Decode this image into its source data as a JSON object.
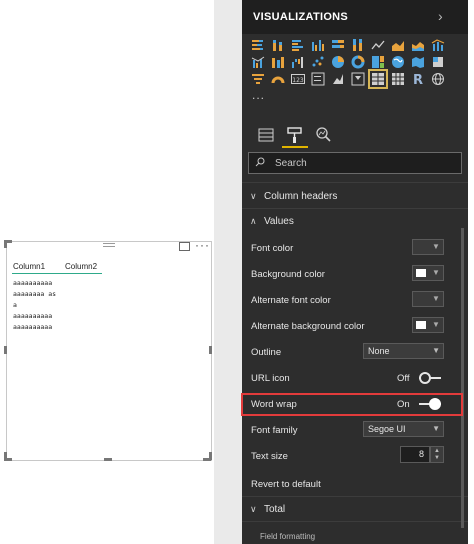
{
  "pane": {
    "title": "VISUALIZATIONS",
    "gallery_more": "...",
    "search_placeholder": "Search"
  },
  "visual": {
    "columns": [
      "Column1",
      "Column2"
    ],
    "rows": [
      "aaaaaaaaaa",
      "aaaaaaaa as",
      "a",
      "aaaaaaaaaa",
      "aaaaaaaaaa"
    ]
  },
  "format": {
    "sections": {
      "column_headers": "Column headers",
      "values": "Values",
      "total": "Total",
      "field_formatting_partial": "Field formatting"
    },
    "rows": {
      "font_color": "Font color",
      "background_color": "Background color",
      "alternate_font_color": "Alternate font color",
      "alternate_background_color": "Alternate background color",
      "outline": "Outline",
      "outline_value": "None",
      "url_icon": "URL icon",
      "url_icon_state": "Off",
      "word_wrap": "Word wrap",
      "word_wrap_state": "On",
      "font_family": "Font family",
      "font_family_value": "Segoe UI",
      "text_size": "Text size",
      "text_size_value": "8",
      "revert": "Revert to default"
    },
    "colors": {
      "font_color": "#3a3a3a",
      "background_color": "#ffffff",
      "alternate_font_color": "#3a3a3a",
      "alternate_background_color": "#ffffff"
    }
  },
  "colors": {
    "pane_bg": "#2d2d2d",
    "accent_tab": "#e0b400",
    "highlight": "#e23b3b",
    "header_underline": "#2eaa8a"
  }
}
